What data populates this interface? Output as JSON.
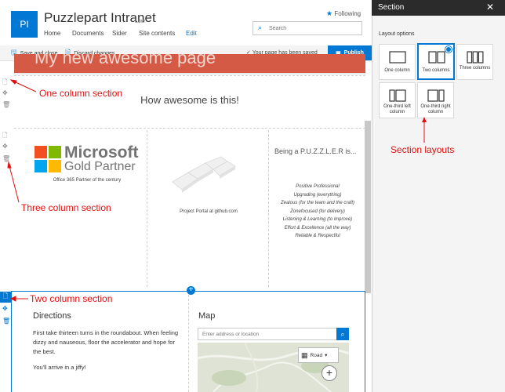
{
  "header": {
    "logo_initials": "PI",
    "site_title": "Puzzlepart Intranet",
    "badge": "Low",
    "nav": [
      "Home",
      "Documents",
      "Sider",
      "Site contents"
    ],
    "edit_link": "Edit",
    "follow": "Following",
    "search_placeholder": "Search"
  },
  "toolbar": {
    "save_close": "Save and close",
    "discard": "Discard changes",
    "status": "Your page has been saved",
    "publish": "Publish"
  },
  "page": {
    "banner_title": "My new awesome page",
    "one_column_text": "How awesome is this!",
    "ms_name": "Microsoft",
    "ms_gold": "Gold Partner",
    "ms_caption": "Office 365 Partner of the century",
    "jigsaw_caption": "Project Portal at github.com",
    "puzzler_title": "Being a P.U.Z.Z.L.E.R is...",
    "puzzler_items": [
      "Positive Professional",
      "Upgrading (everything)",
      "Zealous (for the team and the craft)",
      "Zonefocused (for delivery)",
      "Listening & Learning (to improve)",
      "Effort & Excellence (all the way)",
      "Reliable & Respectful"
    ],
    "directions_heading": "Directions",
    "directions_p1": "First take thirteen turns in the roundabout. When feeling dizzy and nauseous, floor the accelerator and hope for the best.",
    "directions_p2": "You'll arrive in a jiffy!",
    "map_heading": "Map",
    "map_placeholder": "Enter address or location",
    "map_style": "Road"
  },
  "annotations": {
    "one_column": "One column section",
    "three_column": "Three column section",
    "two_column": "Two column section",
    "section_layouts": "Section layouts"
  },
  "panel": {
    "title": "Section",
    "subtitle": "Layout options",
    "options": [
      {
        "label": "One column",
        "selected": false,
        "icon": "one-column-icon"
      },
      {
        "label": "Two columns",
        "selected": true,
        "icon": "two-columns-icon"
      },
      {
        "label": "Three columns",
        "selected": false,
        "icon": "three-columns-icon"
      },
      {
        "label": "One-third left column",
        "selected": false,
        "icon": "one-third-left-icon"
      },
      {
        "label": "One-third right column",
        "selected": false,
        "icon": "one-third-right-icon"
      }
    ]
  },
  "colors": {
    "accent": "#0078d4",
    "banner": "#d55a45",
    "annotation": "#e01010",
    "ms_red": "#f25022",
    "ms_green": "#7fba00",
    "ms_blue": "#00a4ef",
    "ms_yellow": "#ffb900"
  }
}
